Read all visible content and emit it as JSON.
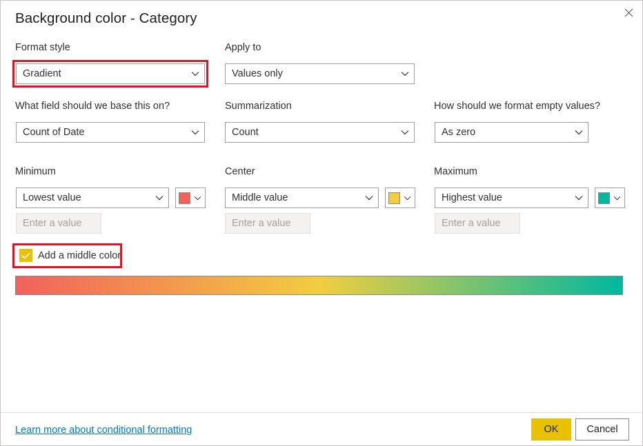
{
  "dialog": {
    "title": "Background color - Category",
    "close_icon": "close-icon"
  },
  "format_style": {
    "label": "Format style",
    "value": "Gradient"
  },
  "apply_to": {
    "label": "Apply to",
    "value": "Values only"
  },
  "base_field": {
    "label": "What field should we base this on?",
    "value": "Count of Date"
  },
  "summarization": {
    "label": "Summarization",
    "value": "Count"
  },
  "empty_values": {
    "label": "How should we format empty values?",
    "value": "As zero"
  },
  "minimum": {
    "label": "Minimum",
    "value": "Lowest value",
    "color": "#F2615C",
    "input_placeholder": "Enter a value",
    "input_value": ""
  },
  "center": {
    "label": "Center",
    "value": "Middle value",
    "color": "#F2CE3F",
    "input_placeholder": "Enter a value",
    "input_value": ""
  },
  "maximum": {
    "label": "Maximum",
    "value": "Highest value",
    "color": "#00B8A0",
    "input_placeholder": "Enter a value",
    "input_value": ""
  },
  "middle_color": {
    "label": "Add a middle color",
    "checked": true,
    "check_color": "#E8C100"
  },
  "gradient_preview": {
    "stops": [
      "#F2615C",
      "#F2CE3F",
      "#00B8A0"
    ]
  },
  "footer": {
    "link": "Learn more about conditional formatting",
    "ok": "OK",
    "cancel": "Cancel"
  },
  "highlight_color": "#E81123"
}
